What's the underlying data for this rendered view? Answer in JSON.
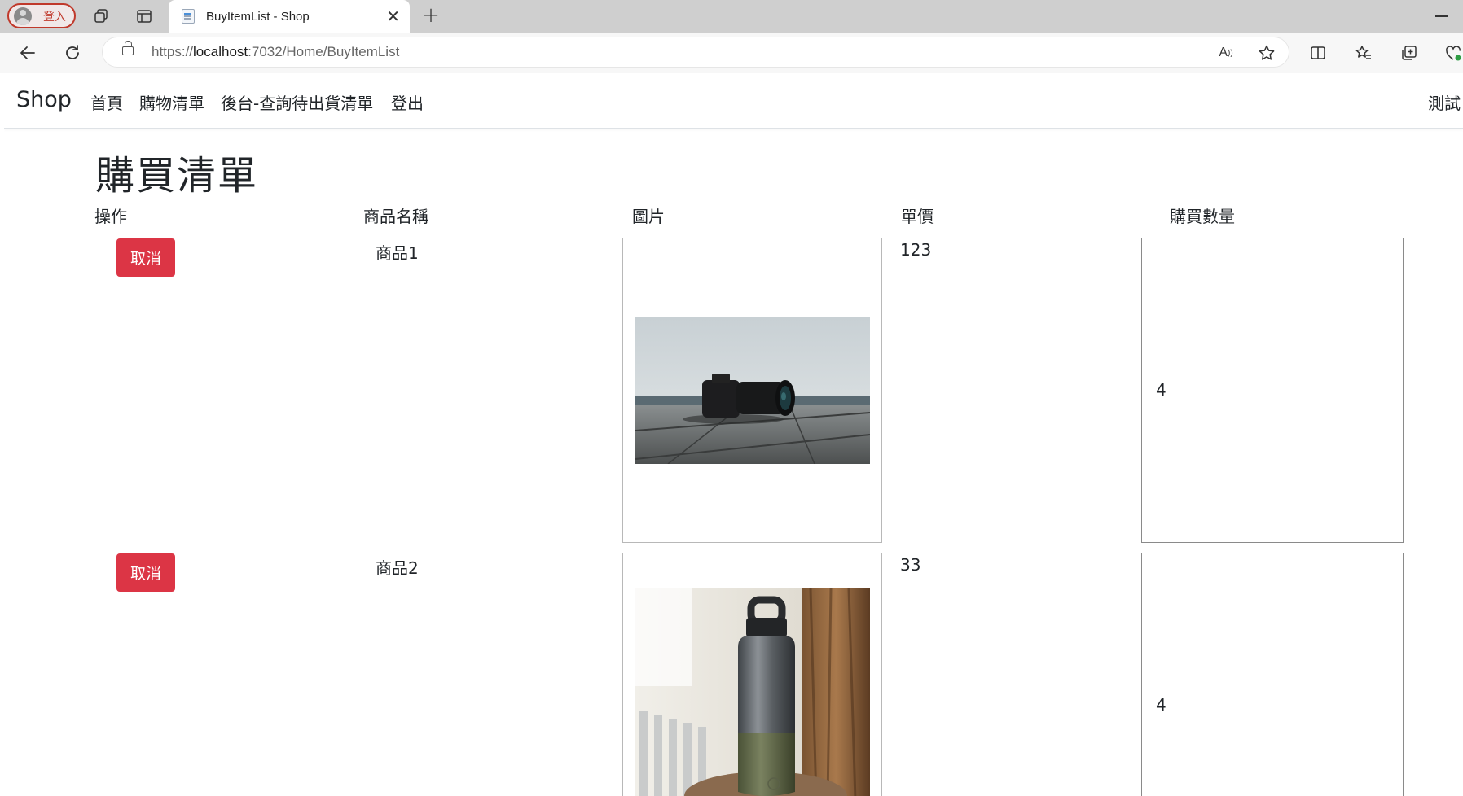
{
  "browser": {
    "profile_label": "登入",
    "tab_title": "BuyItemList - Shop",
    "url_prefix": "https://",
    "url_host": "localhost",
    "url_path": ":7032/Home/BuyItemList"
  },
  "navbar": {
    "brand": "Shop",
    "links": [
      "首頁",
      "購物清單",
      "後台-查詢待出貨清單",
      "登出"
    ],
    "user": "測試"
  },
  "page": {
    "title": "購買清單",
    "headers": [
      "操作",
      "商品名稱",
      "圖片",
      "單價",
      "購買數量"
    ]
  },
  "rows": [
    {
      "action": "取消",
      "name": "商品1",
      "image": "camera-photo",
      "price": "123",
      "quantity": "4"
    },
    {
      "action": "取消",
      "name": "商品2",
      "image": "bottle-photo",
      "price": "33",
      "quantity": "4"
    }
  ],
  "colors": {
    "danger": "#dc3545",
    "tabstrip": "#cfcfcf"
  }
}
